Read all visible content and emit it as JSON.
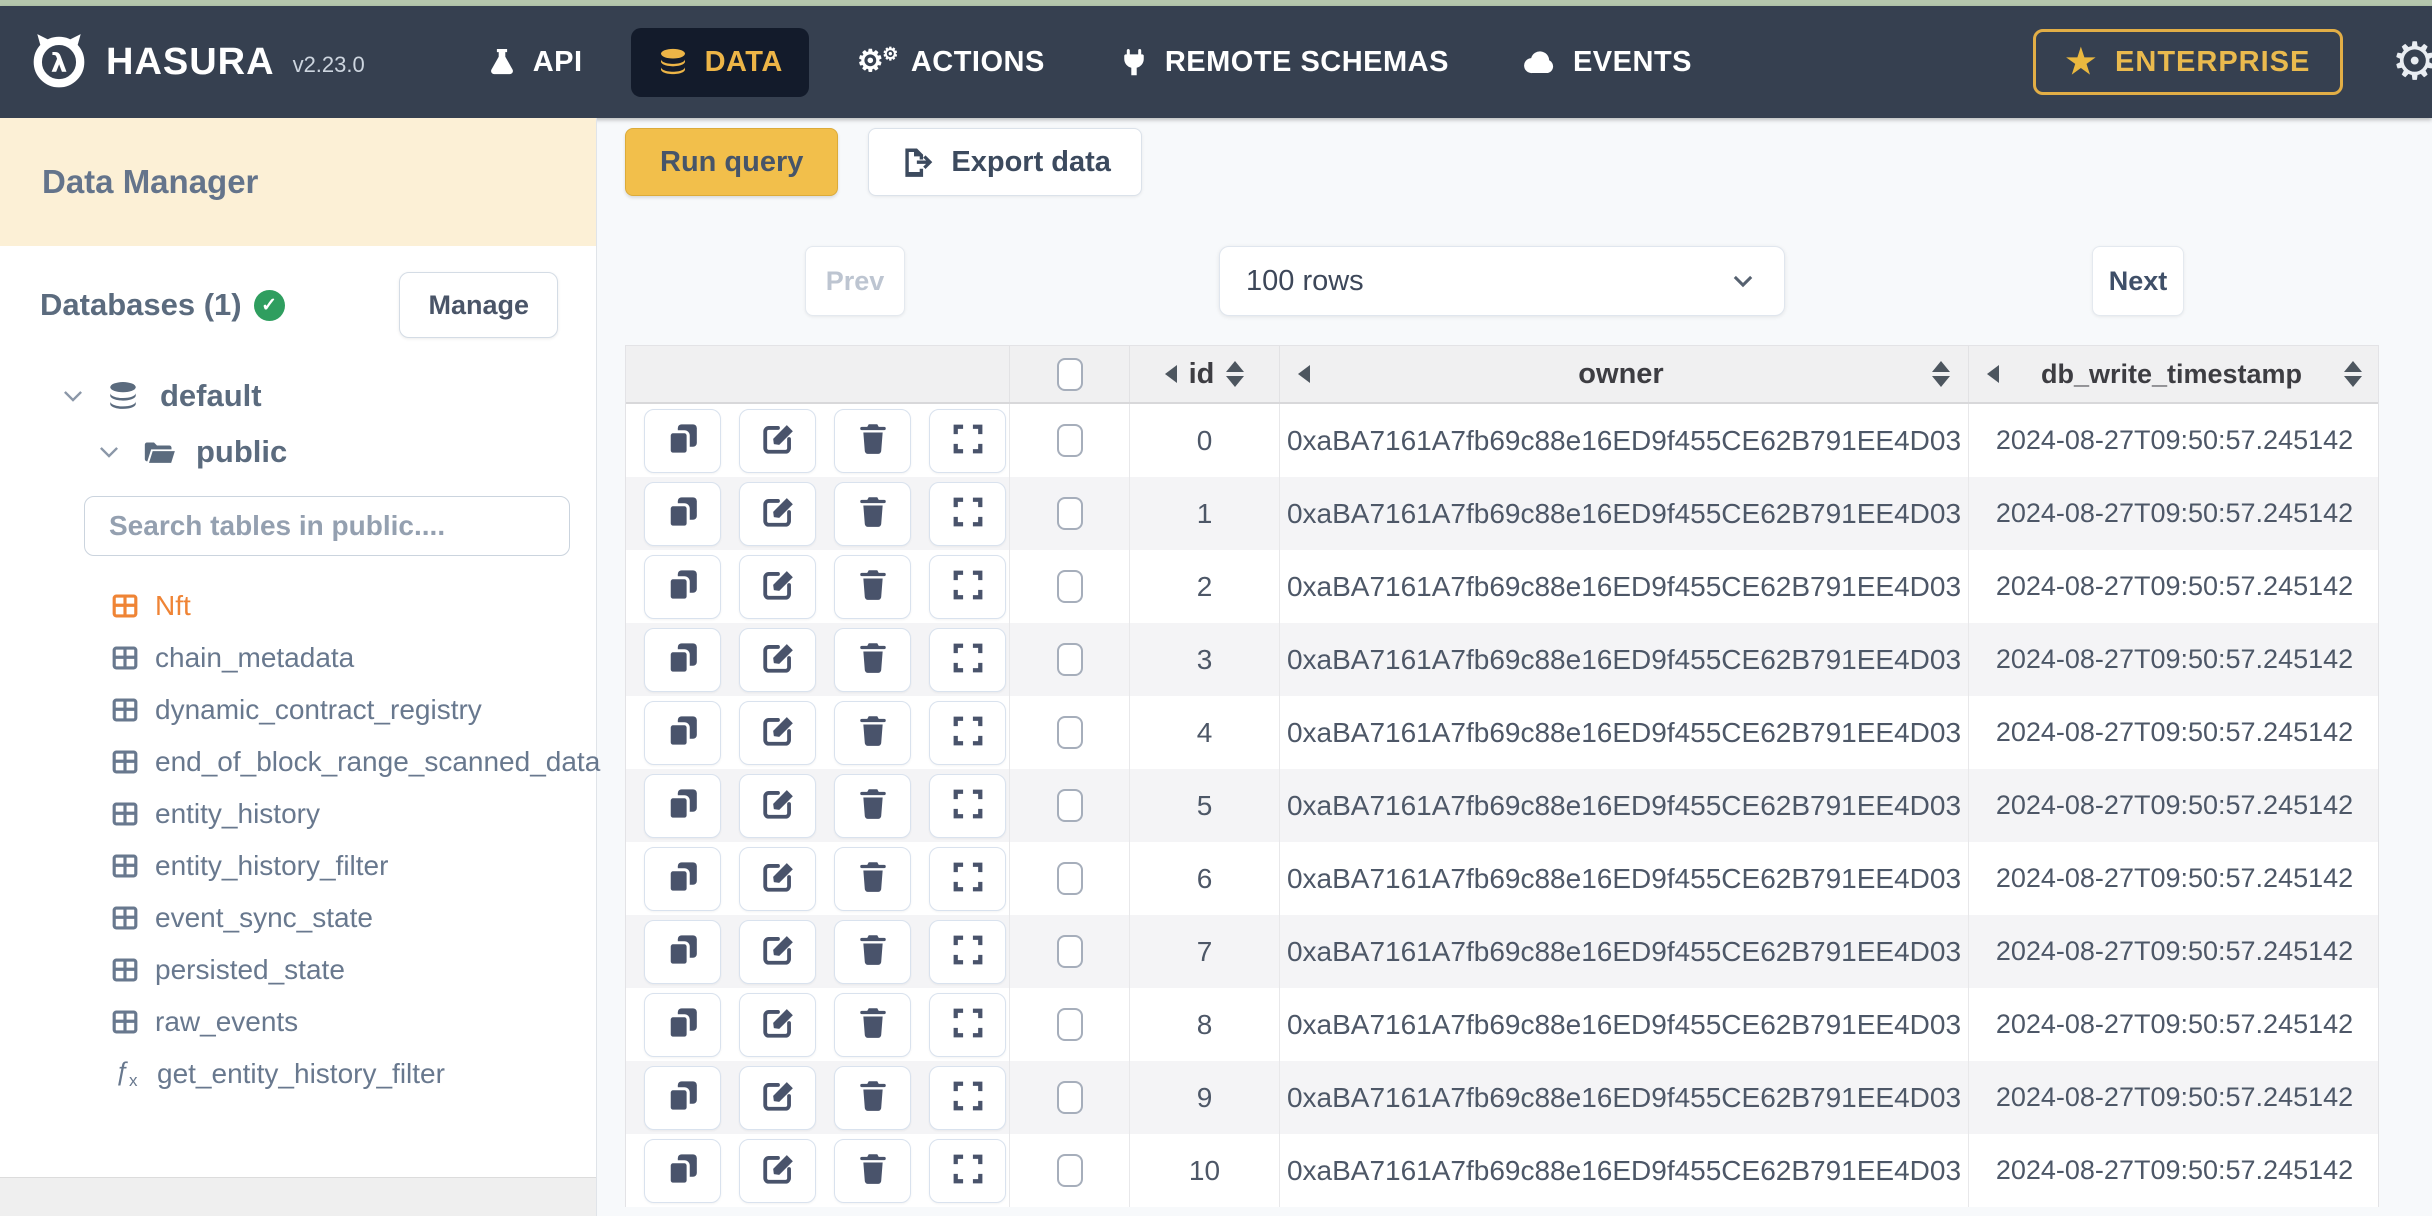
{
  "top_nav": {
    "brand": {
      "name": "HASURA",
      "version": "v2.23.0",
      "logo_glyph": "λ"
    },
    "items": [
      {
        "label": "API",
        "icon": "flask-icon",
        "active": false
      },
      {
        "label": "DATA",
        "icon": "database-icon",
        "active": true
      },
      {
        "label": "ACTIONS",
        "icon": "gears-icon",
        "active": false
      },
      {
        "label": "REMOTE SCHEMAS",
        "icon": "plug-icon",
        "active": false
      },
      {
        "label": "EVENTS",
        "icon": "cloud-icon",
        "active": false
      }
    ],
    "enterprise_label": "ENTERPRISE",
    "settings_icon": "gear-icon"
  },
  "sidebar": {
    "title": "Data Manager",
    "databases_label": "Databases (1)",
    "databases_status_icon": "check-circle-icon",
    "manage_button": "Manage",
    "tree": {
      "database": "default",
      "schema": "public"
    },
    "search_placeholder": "Search tables in public....",
    "tables": [
      {
        "label": "Nft",
        "is_function": false,
        "active": true
      },
      {
        "label": "chain_metadata",
        "is_function": false,
        "active": false
      },
      {
        "label": "dynamic_contract_registry",
        "is_function": false,
        "active": false
      },
      {
        "label": "end_of_block_range_scanned_data",
        "is_function": false,
        "active": false
      },
      {
        "label": "entity_history",
        "is_function": false,
        "active": false
      },
      {
        "label": "entity_history_filter",
        "is_function": false,
        "active": false
      },
      {
        "label": "event_sync_state",
        "is_function": false,
        "active": false
      },
      {
        "label": "persisted_state",
        "is_function": false,
        "active": false
      },
      {
        "label": "raw_events",
        "is_function": false,
        "active": false
      },
      {
        "label": "get_entity_history_filter",
        "is_function": true,
        "active": false
      }
    ]
  },
  "toolbar": {
    "run_query": "Run query",
    "export_data": "Export data",
    "export_icon": "file-export-icon"
  },
  "pagination": {
    "prev": "Prev",
    "rows_select": "100 rows",
    "next": "Next"
  },
  "table": {
    "columns": [
      "id",
      "owner",
      "db_write_timestamp"
    ],
    "row_action_icons": [
      "clone-icon",
      "edit-icon",
      "trash-icon",
      "expand-icon"
    ],
    "rows": [
      {
        "id": "0",
        "owner": "0xaBA7161A7fb69c88e16ED9f455CE62B791EE4D03",
        "db_write_timestamp": "2024-08-27T09:50:57.245142"
      },
      {
        "id": "1",
        "owner": "0xaBA7161A7fb69c88e16ED9f455CE62B791EE4D03",
        "db_write_timestamp": "2024-08-27T09:50:57.245142"
      },
      {
        "id": "2",
        "owner": "0xaBA7161A7fb69c88e16ED9f455CE62B791EE4D03",
        "db_write_timestamp": "2024-08-27T09:50:57.245142"
      },
      {
        "id": "3",
        "owner": "0xaBA7161A7fb69c88e16ED9f455CE62B791EE4D03",
        "db_write_timestamp": "2024-08-27T09:50:57.245142"
      },
      {
        "id": "4",
        "owner": "0xaBA7161A7fb69c88e16ED9f455CE62B791EE4D03",
        "db_write_timestamp": "2024-08-27T09:50:57.245142"
      },
      {
        "id": "5",
        "owner": "0xaBA7161A7fb69c88e16ED9f455CE62B791EE4D03",
        "db_write_timestamp": "2024-08-27T09:50:57.245142"
      },
      {
        "id": "6",
        "owner": "0xaBA7161A7fb69c88e16ED9f455CE62B791EE4D03",
        "db_write_timestamp": "2024-08-27T09:50:57.245142"
      },
      {
        "id": "7",
        "owner": "0xaBA7161A7fb69c88e16ED9f455CE62B791EE4D03",
        "db_write_timestamp": "2024-08-27T09:50:57.245142"
      },
      {
        "id": "8",
        "owner": "0xaBA7161A7fb69c88e16ED9f455CE62B791EE4D03",
        "db_write_timestamp": "2024-08-27T09:50:57.245142"
      },
      {
        "id": "9",
        "owner": "0xaBA7161A7fb69c88e16ED9f455CE62B791EE4D03",
        "db_write_timestamp": "2024-08-27T09:50:57.245142"
      },
      {
        "id": "10",
        "owner": "0xaBA7161A7fb69c88e16ED9f455CE62B791EE4D03",
        "db_write_timestamp": "2024-08-27T09:50:57.245142"
      }
    ]
  },
  "colors": {
    "navbar_bg": "#364050",
    "active_tab_bg": "#131b2b",
    "brand_yellow": "#edb547",
    "run_query_yellow": "#f2bf4b",
    "active_table_orange": "#ef8435",
    "dm_header_cream": "#fcf0d6",
    "status_green": "#2f9e5f",
    "top_strip_green": "#b5c6ad"
  }
}
